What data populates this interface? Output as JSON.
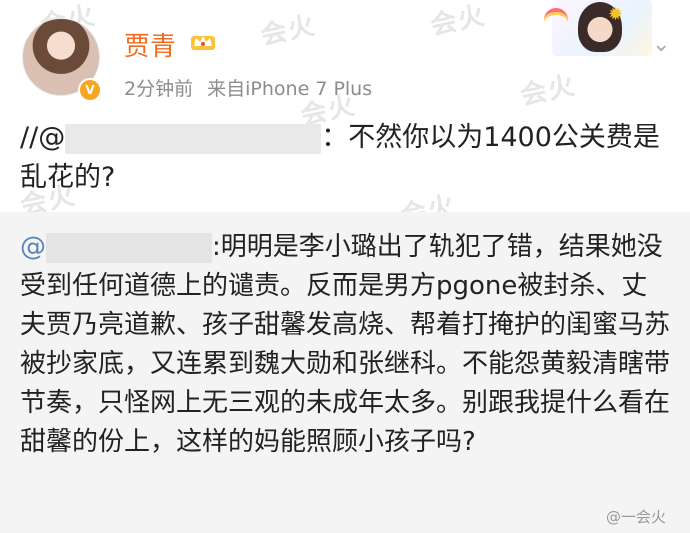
{
  "post": {
    "author_name": "贾青",
    "time": "2分钟前",
    "source": "来自iPhone 7 Plus",
    "prefix": "//@",
    "colon": "：",
    "main_text": "不然你以为1400公关费是乱花的?"
  },
  "repost": {
    "at": "@",
    "text_line1": ":明明是李小璐出了轨犯了错，结果",
    "text_rest": "她没受到任何道德上的谴责。反而是男方pgone被封杀、丈夫贾乃亮道歉、孩子甜馨发高烧、帮着打掩护的闺蜜马苏被抄家底，又连累到魏大勋和张继科。不能怨黄毅清瞎带节奏，只怪网上无三观的未成年太多。别跟我提什么看在甜馨的份上，这样的妈能照顾小孩子吗?"
  },
  "watermark": {
    "text": "@一会火",
    "tile": "会火"
  },
  "icons": [
    "avatar",
    "verified-badge",
    "crown-icon",
    "chevron-down-icon",
    "card-decoration"
  ],
  "colors": {
    "author_name": "#f26b1d",
    "at_link": "#5a86b6",
    "repost_bg": "#f4f4f4"
  }
}
